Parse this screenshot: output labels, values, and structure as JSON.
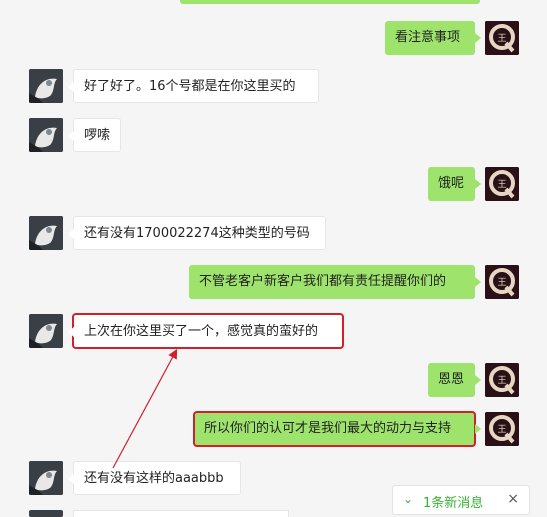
{
  "messages": [
    {
      "side": "right",
      "text": "看注意事项"
    },
    {
      "side": "left",
      "text": "好了好了。16个号都是在你这里买的"
    },
    {
      "side": "left",
      "text": "啰嗦"
    },
    {
      "side": "right",
      "text": "饿呢"
    },
    {
      "side": "left",
      "text": "还有没有1700022274这种类型的号码"
    },
    {
      "side": "right",
      "text": "不管老客户新客户我们都有责任提醒你们的"
    },
    {
      "side": "left",
      "text": "上次在你这里买了一个，感觉真的蛮好的"
    },
    {
      "side": "right",
      "text": "恩恩"
    },
    {
      "side": "right",
      "text": "所以你们的认可才是我们最大的动力与支持"
    },
    {
      "side": "left",
      "text": "还有没有这样的aaabbb"
    }
  ],
  "new_message_toast": {
    "text": "1条新消息",
    "chevron": "⌄",
    "close": "×"
  },
  "colors": {
    "outgoing": "#9de36c",
    "incoming": "#ffffff",
    "highlight": "#d21f2a",
    "toast_text": "#36b336"
  },
  "avatar_right_glyph": "Q"
}
